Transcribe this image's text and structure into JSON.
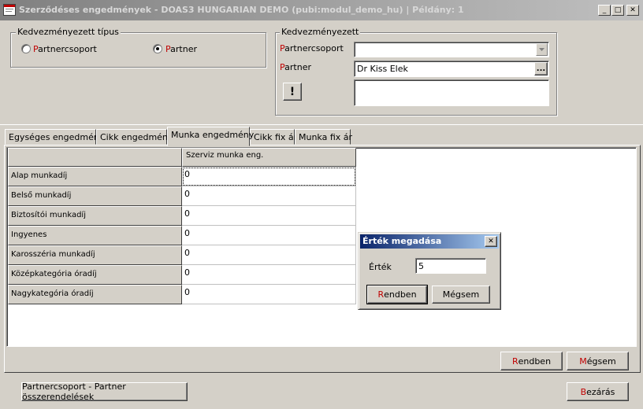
{
  "window": {
    "title": "Szerződéses engedmények - DOAS3 HUNGARIAN DEMO (pubi:modul_demo_hu)  |  Példány: 1",
    "minimize": "_",
    "maximize": "□",
    "close": "✕"
  },
  "type_group": {
    "legend": "Kedvezményezett típus",
    "option1_first": "P",
    "option1_rest": "artnercsoport",
    "option2_first": "P",
    "option2_rest": "artner",
    "selected": "Partner"
  },
  "beneficiary_group": {
    "legend": "Kedvezményezett",
    "partnercsoport_first": "P",
    "partnercsoport_rest": "artnercsoport",
    "partner_first": "P",
    "partner_rest": "artner",
    "partnercsoport_value": "",
    "partner_value": "Dr Kiss Elek",
    "browse": "...",
    "info": "!"
  },
  "tabs": [
    {
      "label": "Egységes engedmény"
    },
    {
      "label": "Cikk engedmény"
    },
    {
      "label": "Munka engedmény"
    },
    {
      "label": "Cikk fix ár"
    },
    {
      "label": "Munka fix ár"
    }
  ],
  "active_tab": "Munka engedmény",
  "grid": {
    "column_header": "Szerviz munka eng.",
    "rows": [
      {
        "label": "Alap munkadíj",
        "value": "0"
      },
      {
        "label": "Belső munkadíj",
        "value": "0"
      },
      {
        "label": "Biztosítói munkadíj",
        "value": "0"
      },
      {
        "label": "Ingyenes",
        "value": "0"
      },
      {
        "label": "Karosszéria munkadíj",
        "value": "0"
      },
      {
        "label": "Középkategória óradíj",
        "value": "0"
      },
      {
        "label": "Nagykategória óradíj",
        "value": "0"
      }
    ]
  },
  "dialog": {
    "title": "Érték megadása",
    "close": "✕",
    "field_label": "Érték",
    "field_value": "5",
    "ok_first": "R",
    "ok_rest": "endben",
    "cancel_label": "Mégsem"
  },
  "bottom": {
    "ok_first": "R",
    "ok_rest": "endben",
    "cancel_first": "M",
    "cancel_rest": "égsem",
    "assign_label": "Partnercsoport - Partner összerendelések",
    "close_first": "B",
    "close_rest": "ezárás"
  },
  "colors": {
    "titlebar_start": "#808080",
    "titlebar_end": "#c0c0c0",
    "dialog_title_start": "#0a246a",
    "dialog_title_end": "#a6caf0",
    "accent_red": "#c00000",
    "face": "#d4d0c8"
  }
}
